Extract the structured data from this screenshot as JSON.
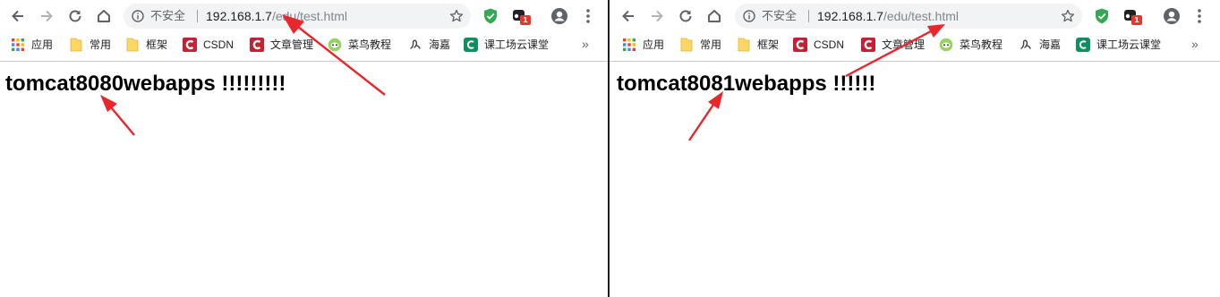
{
  "windows": [
    {
      "omnibox": {
        "security_label": "不安全",
        "url_host": "192.168.1.7",
        "url_path": "/edu/test.html"
      },
      "extensions": {
        "badge_count": "1"
      },
      "bookmarks": [
        {
          "label": "应用",
          "icon": "apps-grid-icon"
        },
        {
          "label": "常用",
          "icon": "folder-icon"
        },
        {
          "label": "框架",
          "icon": "folder-icon"
        },
        {
          "label": "CSDN",
          "icon": "csdn-icon"
        },
        {
          "label": "文章管理",
          "icon": "csdn-icon"
        },
        {
          "label": "菜鸟教程",
          "icon": "runoob-icon"
        },
        {
          "label": "海嘉",
          "icon": "script-icon"
        },
        {
          "label": "课工场云课堂",
          "icon": "kgc-icon"
        }
      ],
      "page": {
        "heading": "tomcat8080webapps !!!!!!!!!"
      }
    },
    {
      "omnibox": {
        "security_label": "不安全",
        "url_host": "192.168.1.7",
        "url_path": "/edu/test.html"
      },
      "extensions": {
        "badge_count": "1"
      },
      "bookmarks": [
        {
          "label": "应用",
          "icon": "apps-grid-icon"
        },
        {
          "label": "常用",
          "icon": "folder-icon"
        },
        {
          "label": "框架",
          "icon": "folder-icon"
        },
        {
          "label": "CSDN",
          "icon": "csdn-icon"
        },
        {
          "label": "文章管理",
          "icon": "csdn-icon"
        },
        {
          "label": "菜鸟教程",
          "icon": "runoob-icon"
        },
        {
          "label": "海嘉",
          "icon": "script-icon"
        },
        {
          "label": "课工场云课堂",
          "icon": "kgc-icon"
        }
      ],
      "page": {
        "heading": "tomcat8081webapps !!!!!!"
      }
    }
  ],
  "colors": {
    "annotation_arrow": "#e8262b",
    "csdn_red": "#c32136",
    "folder_yellow": "#fdd663",
    "shield_green": "#34a853",
    "badge_red": "#e8362f",
    "kgc_green": "#0d8f5e"
  }
}
